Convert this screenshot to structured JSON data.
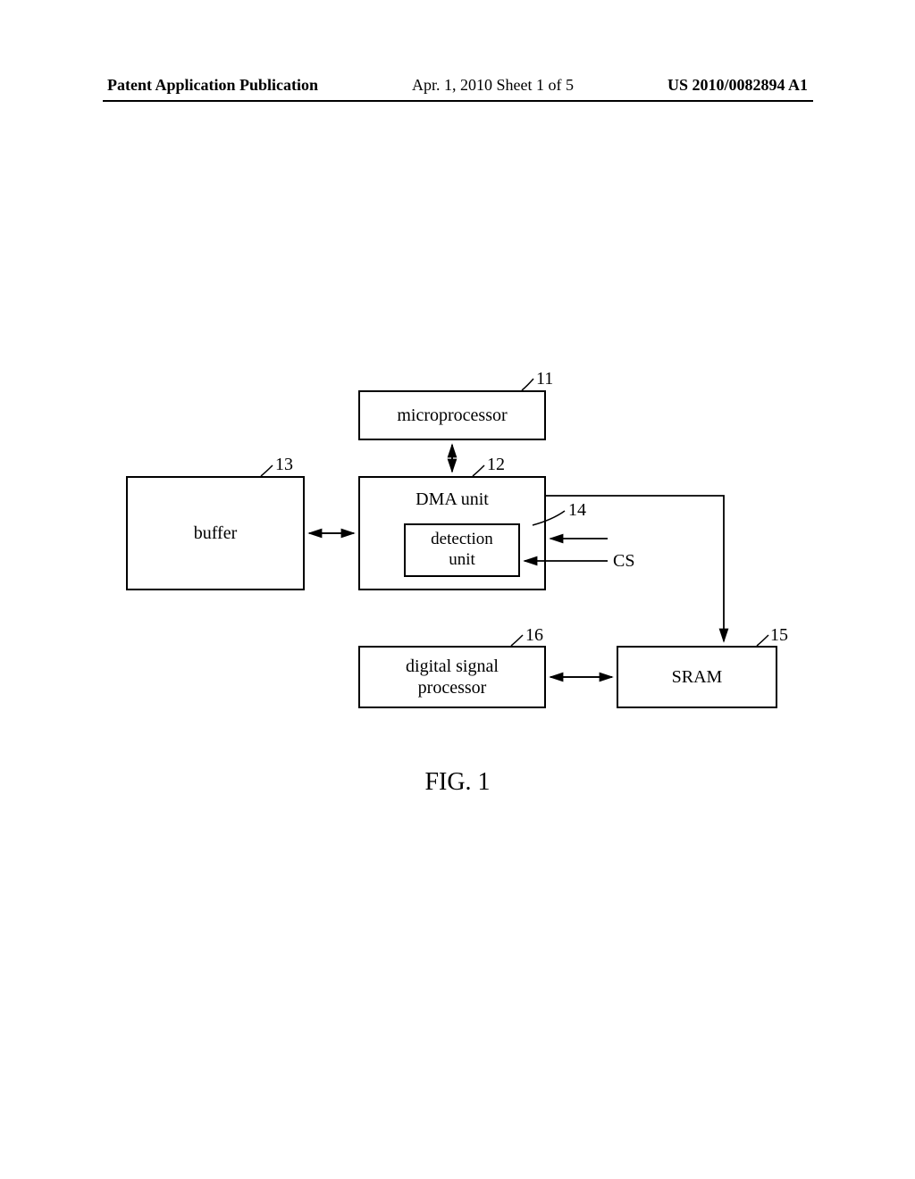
{
  "header": {
    "left": "Patent Application Publication",
    "center": "Apr. 1, 2010  Sheet 1 of 5",
    "right": "US 2010/0082894 A1"
  },
  "blocks": {
    "microprocessor": "microprocessor",
    "dma": "DMA unit",
    "detection": "detection\nunit",
    "buffer": "buffer",
    "dsp": "digital signal\nprocessor",
    "sram": "SRAM"
  },
  "refs": {
    "r11": "11",
    "r12": "12",
    "r13": "13",
    "r14": "14",
    "r15": "15",
    "r16": "16"
  },
  "signals": {
    "cs": "CS"
  },
  "figure": "FIG.  1"
}
